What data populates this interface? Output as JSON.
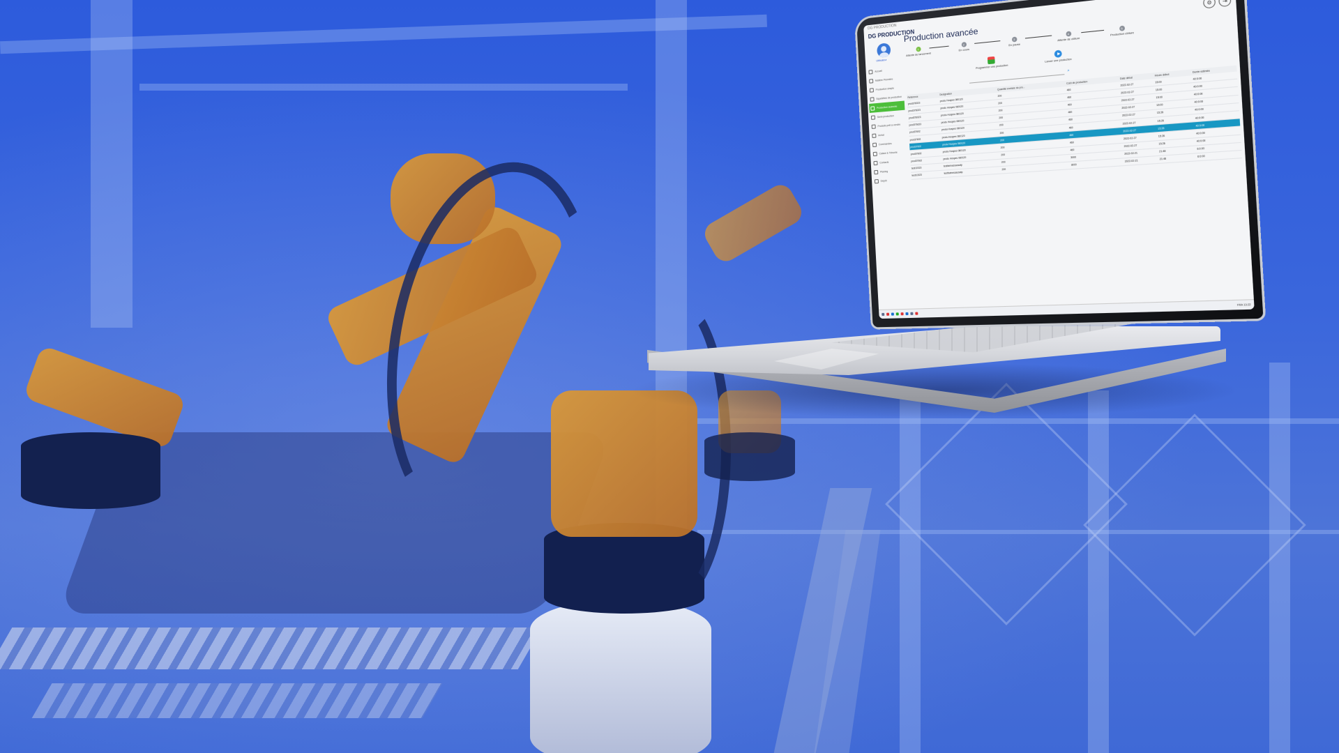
{
  "app": {
    "window_title": "DG PRODUCTION",
    "brand": "DG PRODUCTION",
    "window_controls": "— ▢ ✕",
    "user_name": "Utilisateur"
  },
  "sidebar": {
    "items": [
      {
        "label": "Accueil",
        "icon": "home-icon"
      },
      {
        "label": "Matière Première",
        "icon": "box-icon"
      },
      {
        "label": "Production simple",
        "icon": "play-icon"
      },
      {
        "label": "Squelettes de production",
        "icon": "gear-icon"
      },
      {
        "label": "Production avancée",
        "icon": "play-icon"
      },
      {
        "label": "Semi-production",
        "icon": "gear-icon"
      },
      {
        "label": "Produits prêt à vendre",
        "icon": "chart-icon"
      },
      {
        "label": "Achat",
        "icon": "cart-icon"
      },
      {
        "label": "Commandes",
        "icon": "list-icon"
      },
      {
        "label": "Caisse & Trésorie",
        "icon": "cash-icon"
      },
      {
        "label": "Contacts",
        "icon": "contact-icon"
      },
      {
        "label": "Planing",
        "icon": "calendar-icon"
      },
      {
        "label": "Dépôt",
        "icon": "warehouse-icon"
      }
    ],
    "active_index": 4,
    "active_color": "#4cbe3a"
  },
  "main": {
    "title": "Production avancée",
    "settings_icon": "gear-icon",
    "logout_icon": "logout-icon",
    "steps": [
      {
        "num": "1",
        "label": "Attente de lancement",
        "done": true
      },
      {
        "num": "2",
        "label": "En cours",
        "done": false
      },
      {
        "num": "3",
        "label": "En pause",
        "done": false
      },
      {
        "num": "4",
        "label": "Attente de clôture",
        "done": false
      },
      {
        "num": "5",
        "label": "Production clôture",
        "done": false
      }
    ],
    "actions": {
      "program_label": "Programmer une production",
      "launch_label": "Lancer une production"
    },
    "search_placeholder": "",
    "table": {
      "headers": [
        "Reference",
        "Designation",
        "Quantité envisée du pro...",
        "Coût de production",
        "Date début",
        "Heure début",
        "Durée estimée"
      ],
      "rows": [
        [
          "prod376023",
          "produ Hospes 080120",
          "200",
          "460",
          "2022-02-27",
          "15:00",
          "40:0:00"
        ],
        [
          "prod376023",
          "produ Hospes 080120",
          "200",
          "460",
          "2022-02-27",
          "15:00",
          "40:0:00"
        ],
        [
          "prod376023",
          "produ Hospes 080120",
          "200",
          "460",
          "2022-02-27",
          "15:00",
          "40:0:00"
        ],
        [
          "prod376023",
          "produ Hospes 080120",
          "200",
          "460",
          "2022-02-27",
          "15:00",
          "40:0:00"
        ],
        [
          "prod37602",
          "produ Hospes 080120",
          "200",
          "460",
          "2022-02-27",
          "15:26",
          "40:0:00"
        ],
        [
          "prod37602",
          "produ Hospes 080120",
          "200",
          "460",
          "2022-02-27",
          "15:26",
          "40:0:00"
        ],
        [
          "prod37602",
          "produ Hospes 080120",
          "200",
          "460",
          "2022-02-27",
          "15:26",
          "40:0:00"
        ],
        [
          "prod37602",
          "produ Hospes 080120",
          "200",
          "460",
          "2022-02-27",
          "15:26",
          "40:0:00"
        ],
        [
          "prod37602",
          "produ Hospes 080120",
          "200",
          "460",
          "2022-02-27",
          "15:26",
          "40:0:00"
        ],
        [
          "test10323",
          "testfarinessacsatp",
          "200",
          "3000",
          "2022-02-21",
          "21:48",
          "6:0:00"
        ],
        [
          "test10323",
          "testfarinessacsatp",
          "200",
          "3000",
          "2022-02-21",
          "21:48",
          "6:0:00"
        ]
      ],
      "selected_index": 6,
      "selected_color": "#1897c3"
    }
  },
  "taskbar": {
    "clock": "FRA  13:22"
  }
}
